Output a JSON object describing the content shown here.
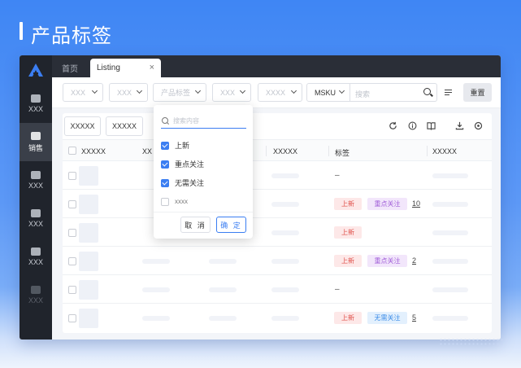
{
  "hero": {
    "title": "产品标签"
  },
  "sidebar": {
    "items": [
      {
        "label": "XXX",
        "icon": "bag-icon"
      },
      {
        "label": "销售",
        "icon": "sell-icon",
        "active": true
      },
      {
        "label": "XXX",
        "icon": "dollar-icon"
      },
      {
        "label": "XXX",
        "icon": "cart-icon"
      },
      {
        "label": "XXX",
        "icon": "camera-icon"
      },
      {
        "label": "XXX",
        "icon": "truck-icon",
        "dim": true
      }
    ]
  },
  "tabs": {
    "home": "首页",
    "active": "Listing",
    "close": "×"
  },
  "filters": {
    "selects": [
      "XXX",
      "XXX",
      "产品标签",
      "XXX",
      "XXXX"
    ],
    "msku": "MSKU",
    "search_placeholder": "搜索",
    "reset": "重置"
  },
  "toolbar": {
    "buttons": [
      "XXXXX",
      "XXXXX"
    ]
  },
  "table": {
    "headers": [
      "XXXXX",
      "XX",
      "XXXXX",
      "标签",
      "XXXXX"
    ],
    "rows": [
      {
        "tag_dash": "–",
        "chips": [],
        "count": ""
      },
      {
        "tag_dash": "",
        "chips": [
          "上新",
          "重点关注"
        ],
        "count": "10"
      },
      {
        "tag_dash": "",
        "chips": [
          "上新"
        ],
        "count": ""
      },
      {
        "tag_dash": "",
        "chips": [
          "上新",
          "重点关注"
        ],
        "count": "2"
      },
      {
        "tag_dash": "–",
        "chips": [],
        "count": ""
      },
      {
        "tag_dash": "",
        "chips": [
          "上新",
          "无需关注"
        ],
        "count": "5"
      }
    ]
  },
  "dropdown": {
    "search_placeholder": "搜索内容",
    "options": [
      {
        "label": "上新",
        "checked": true
      },
      {
        "label": "重点关注",
        "checked": true
      },
      {
        "label": "无需关注",
        "checked": true
      },
      {
        "label": "xxxx",
        "checked": false
      }
    ],
    "cancel": "取 消",
    "ok": "确 定"
  },
  "colors": {
    "accent": "#3b7ef2",
    "chip_new": "#e0504a",
    "chip_focus": "#a15fd8",
    "chip_none": "#3c8ce8",
    "sidebar_bg": "#20242c"
  }
}
